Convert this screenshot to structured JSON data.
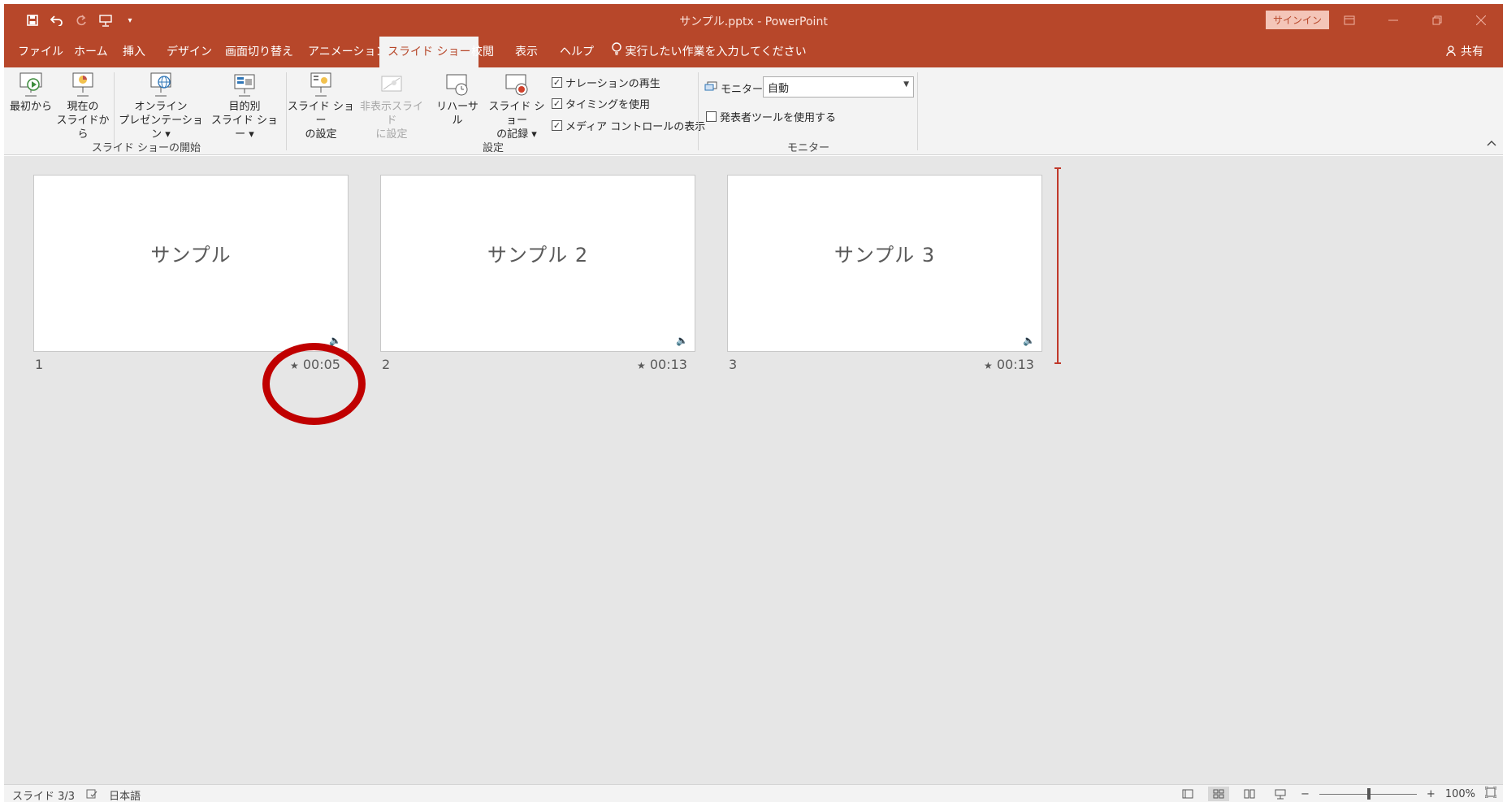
{
  "window": {
    "title": "サンプル.pptx  -  PowerPoint",
    "signin": "サインイン"
  },
  "qat": {
    "save_icon": "save-icon",
    "undo_icon": "undo-icon",
    "redo_icon": "redo-icon",
    "present_icon": "present-icon",
    "customize_icon": "customize-qat-icon"
  },
  "tabs": [
    {
      "label": "ファイル"
    },
    {
      "label": "ホーム"
    },
    {
      "label": "挿入"
    },
    {
      "label": "デザイン"
    },
    {
      "label": "画面切り替え"
    },
    {
      "label": "アニメーション"
    },
    {
      "label": "スライド ショー"
    },
    {
      "label": "校閲"
    },
    {
      "label": "表示"
    },
    {
      "label": "ヘルプ"
    }
  ],
  "tell_me": "実行したい作業を入力してください",
  "share": "共有",
  "ribbon": {
    "start_group": {
      "label": "スライド ショーの開始",
      "from_beginning": "最初から",
      "from_current_1": "現在の",
      "from_current_2": "スライドから",
      "online_1": "オンライン",
      "online_2": "プレゼンテーション ▾",
      "custom_1": "目的別",
      "custom_2": "スライド ショー ▾"
    },
    "setup_group": {
      "label": "設定",
      "setup_1": "スライド ショー",
      "setup_2": "の設定",
      "hide_1": "非表示スライド",
      "hide_2": "に設定",
      "rehearse": "リハーサル",
      "record_1": "スライド ショー",
      "record_2": "の記録 ▾",
      "play_narrations": "ナレーションの再生",
      "use_timings": "タイミングを使用",
      "media_controls": "メディア コントロールの表示"
    },
    "monitor_group": {
      "label": "モニター",
      "monitor_label": "モニター:",
      "monitor_value": "自動",
      "presenter_view": "発表者ツールを使用する"
    }
  },
  "slides": [
    {
      "title": "サンプル",
      "number": "1",
      "timing": "00:05"
    },
    {
      "title": "サンプル 2",
      "number": "2",
      "timing": "00:13"
    },
    {
      "title": "サンプル 3",
      "number": "3",
      "timing": "00:13"
    }
  ],
  "status": {
    "slide": "スライド 3/3",
    "language": "日本語",
    "zoom": "100%",
    "zoom_minus": "−",
    "zoom_plus": "+"
  },
  "colors": {
    "accent": "#b7472a",
    "annotation": "#c00000"
  }
}
